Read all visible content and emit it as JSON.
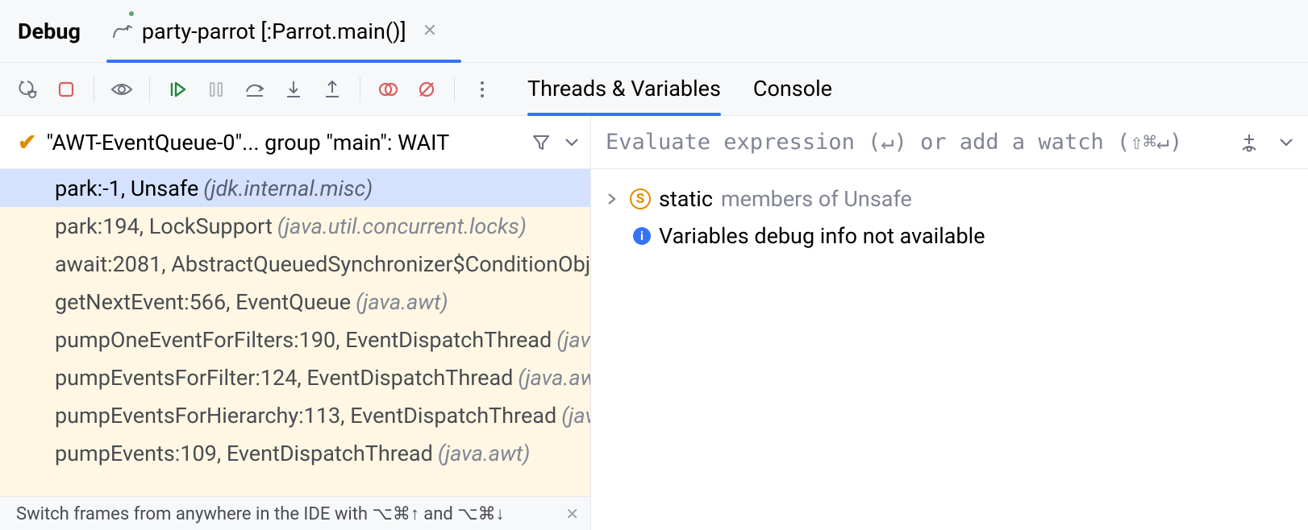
{
  "header": {
    "debug_label": "Debug",
    "run_config_name": "party-parrot [:Parrot.main()]"
  },
  "view_tabs": {
    "threads": "Threads & Variables",
    "console": "Console"
  },
  "thread_selector": {
    "text": "\"AWT-EventQueue-0\"... group \"main\": WAIT"
  },
  "frames": [
    {
      "main": "park:-1, Unsafe",
      "pkg": "(jdk.internal.misc)",
      "selected": true
    },
    {
      "main": "park:194, LockSupport",
      "pkg": "(java.util.concurrent.locks)"
    },
    {
      "main": "await:2081, AbstractQueuedSynchronizer$ConditionObj",
      "pkg": ""
    },
    {
      "main": "getNextEvent:566, EventQueue",
      "pkg": "(java.awt)"
    },
    {
      "main": "pumpOneEventForFilters:190, EventDispatchThread",
      "pkg": "(jav"
    },
    {
      "main": "pumpEventsForFilter:124, EventDispatchThread",
      "pkg": "(java.aw"
    },
    {
      "main": "pumpEventsForHierarchy:113, EventDispatchThread",
      "pkg": "(jav"
    },
    {
      "main": "pumpEvents:109, EventDispatchThread",
      "pkg": "(java.awt)"
    }
  ],
  "tip": {
    "text": "Switch frames from anywhere in the IDE with ⌥⌘↑ and ⌥⌘↓"
  },
  "eval": {
    "placeholder": "Evaluate expression (↵) or add a watch (⇧⌘↵)"
  },
  "vars": {
    "static_prefix": "static",
    "static_suffix": "members of Unsafe",
    "info_msg": "Variables debug info not available"
  }
}
